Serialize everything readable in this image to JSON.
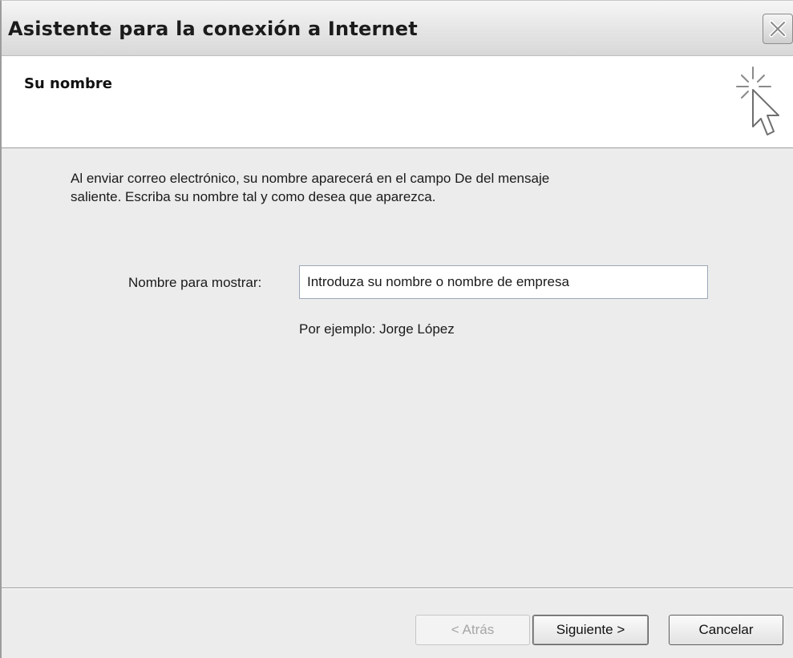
{
  "window": {
    "title": "Asistente para la conexión a Internet",
    "close_icon": "close-icon"
  },
  "header": {
    "title": "Su nombre",
    "icon": "wizard-cursor-sparkle-icon"
  },
  "body": {
    "intro_line1": "Al enviar correo electrónico, su nombre aparecerá en el campo De del mensaje",
    "intro_line2": "saliente. Escriba su nombre tal y como desea que aparezca.",
    "display_name_label": "Nombre para mostrar:",
    "display_name_value": "Introduza su nombre o nombre de empresa",
    "example_text": "Por ejemplo: Jorge López"
  },
  "buttons": {
    "back": "< Atrás",
    "next": "Siguiente >",
    "cancel": "Cancelar"
  }
}
